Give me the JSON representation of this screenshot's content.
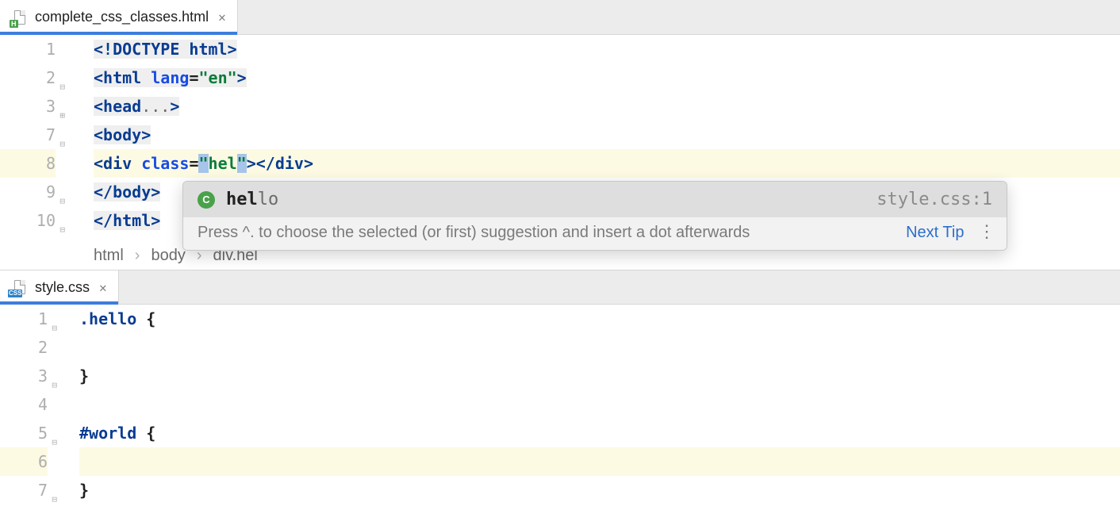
{
  "tabs": {
    "top": {
      "label": "complete_css_classes.html"
    },
    "bottom": {
      "label": "style.css"
    }
  },
  "gutter1": [
    "1",
    "2",
    "3",
    "7",
    "8",
    "9",
    "10"
  ],
  "code1": {
    "l1a": "<!DOCTYPE ",
    "l1b": "html",
    "l1c": ">",
    "l2a": "<",
    "l2b": "html ",
    "l2c": "lang",
    "l2d": "=",
    "l2e": "\"en\"",
    "l2f": ">",
    "l3a": "<",
    "l3b": "head",
    "l3c": "...",
    "l3d": ">",
    "l7a": "<",
    "l7b": "body",
    "l7c": ">",
    "l8a": "<",
    "l8b": "div ",
    "l8c": "class",
    "l8d": "=",
    "l8e": "\"",
    "l8f": "hel",
    "l8g": "\"",
    "l8h": "></",
    "l8i": "div",
    "l8j": ">",
    "l9a": "</",
    "l9b": "body",
    "l9c": ">",
    "l10a": "</",
    "l10b": "html",
    "l10c": ">"
  },
  "breadcrumb": {
    "a": "html",
    "b": "body",
    "c": "div.hel"
  },
  "popup": {
    "match": "hel",
    "rest": "lo",
    "source": "style.css:1",
    "tip": "Press ^. to choose the selected (or first) suggestion and insert a dot afterwards",
    "next": "Next Tip"
  },
  "gutter2": [
    "1",
    "2",
    "3",
    "4",
    "5",
    "6",
    "7"
  ],
  "code2": {
    "l1a": ".hello",
    "l1b": " {",
    "l3": "}",
    "l5a": "#world",
    "l5b": " {",
    "l7": "}"
  }
}
